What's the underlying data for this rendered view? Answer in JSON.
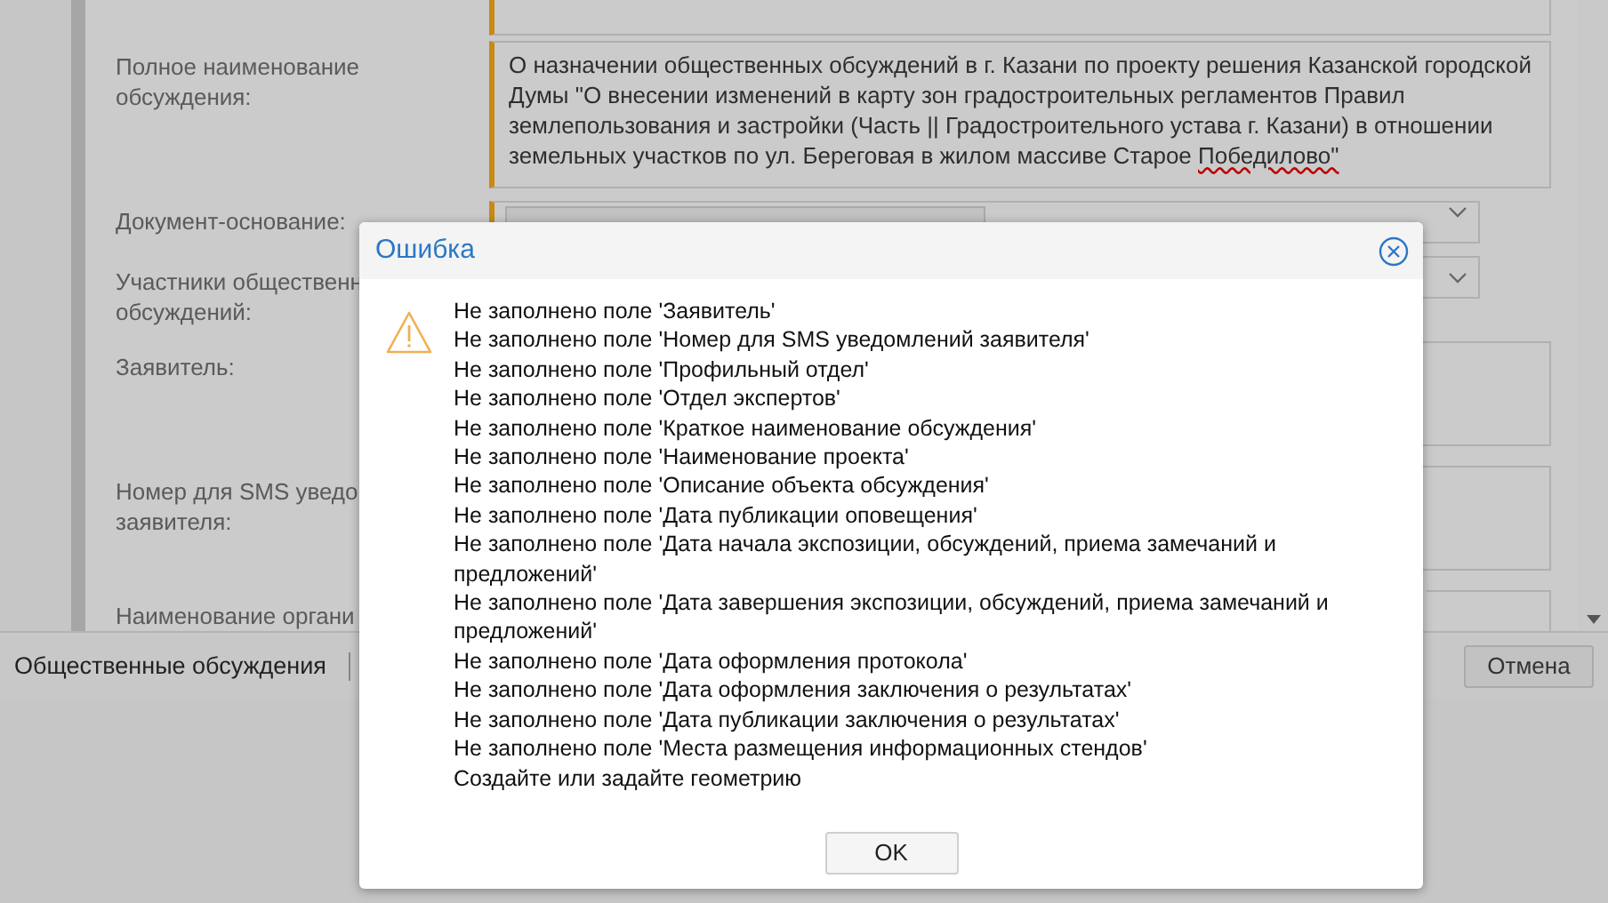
{
  "form": {
    "fields": [
      {
        "kind": "partial"
      },
      {
        "kind": "textarea",
        "label_lines": [
          "Полное наименование",
          "обсуждения:"
        ],
        "value": "О назначении общественных обсуждений в г. Казани по проекту решения Казанской городской Думы \"О внесении изменений в карту зон градостроительных регламентов Правил землепользования и застройки (Часть || Градостроительного устава г. Казани) в отношении земельных участков по ул. Береговая в жилом массиве Старое Победилово\""
      },
      {
        "kind": "select",
        "label_lines": [
          "Документ-основание:"
        ],
        "has_tag": true
      },
      {
        "kind": "select",
        "label_lines": [
          "Участники общественн",
          "обсуждений:"
        ]
      },
      {
        "kind": "textarea",
        "label_lines": [
          "Заявитель:"
        ]
      },
      {
        "kind": "textarea",
        "label_lines": [
          "Номер для SMS уведо",
          "заявителя:"
        ]
      },
      {
        "kind": "textarea",
        "label_lines": [
          "Наименование органи"
        ]
      }
    ]
  },
  "bottom_bar": {
    "title": "Общественные обсуждения",
    "cancel": "Отмена"
  },
  "dialog": {
    "title": "Ошибка",
    "messages": [
      "Не заполнено поле 'Заявитель'",
      "Не заполнено поле 'Номер для SMS уведомлений заявителя'",
      "Не заполнено поле 'Профильный отдел'",
      "Не заполнено поле 'Отдел экспертов'",
      "Не заполнено поле 'Краткое наименование обсуждения'",
      "Не заполнено поле 'Наименование проекта'",
      "Не заполнено поле 'Описание объекта обсуждения'",
      "Не заполнено поле 'Дата публикации оповещения'",
      "Не заполнено поле 'Дата начала экспозиции, обсуждений, приема замечаний и предложений'",
      "Не заполнено поле 'Дата завершения экспозиции, обсуждений, приема замечаний и предложений'",
      "Не заполнено поле 'Дата оформления протокола'",
      "Не заполнено поле 'Дата оформления заключения о результатах'",
      "Не заполнено поле 'Дата публикации заключения о результатах'",
      "Не заполнено поле 'Места размещения информационных стендов'",
      "Создайте или задайте геометрию"
    ],
    "ok": "OK"
  }
}
